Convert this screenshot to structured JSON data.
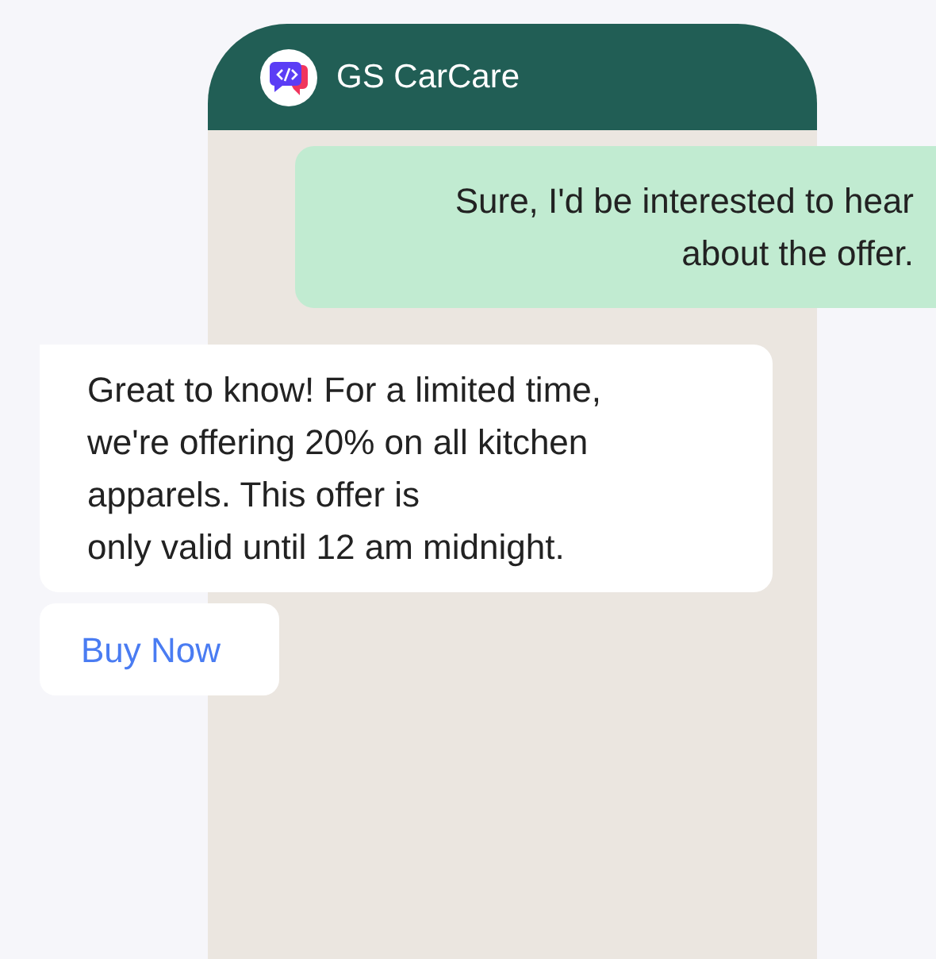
{
  "header": {
    "title": "GS CarCare"
  },
  "messages": [
    {
      "kind": "outgoing",
      "text": "Sure, I'd be interested to hear\nabout the offer."
    },
    {
      "kind": "incoming",
      "text": "Great to know! For a limited time,\nwe're offering 20% on all kitchen\napparels. This offer is\nonly valid until 12 am midnight."
    }
  ],
  "actions": [
    {
      "label": "Buy Now"
    }
  ]
}
